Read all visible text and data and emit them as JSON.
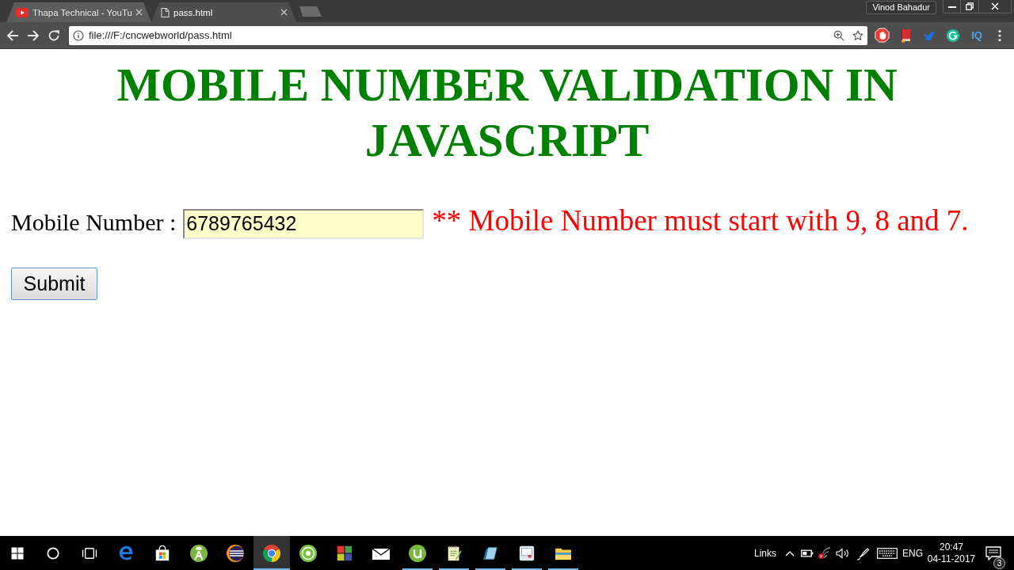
{
  "browser": {
    "tabs": [
      {
        "kind": "video",
        "title": "Thapa Technical - YouTu",
        "selected": false
      },
      {
        "kind": "page",
        "title": "pass.html",
        "selected": true
      }
    ],
    "profile": "Vinod Bahadur",
    "address": "file:///F:/cncwebworld/pass.html",
    "extensions": [
      {
        "kind": "stop"
      },
      {
        "kind": "book"
      },
      {
        "kind": "bird"
      },
      {
        "kind": "gcircle"
      },
      {
        "kind": "text",
        "label": "IQ"
      }
    ]
  },
  "page": {
    "heading": "MOBILE NUMBER VALIDATION IN JAVASCRIPT",
    "form": {
      "label": "Mobile Number :",
      "value": "6789765432",
      "error": "** Mobile Number must start with 9, 8 and 7.",
      "submit": "Submit"
    }
  },
  "taskbar": {
    "apps": [
      {
        "kind": "edge",
        "running": false,
        "selected": false
      },
      {
        "kind": "store",
        "running": false,
        "selected": false
      },
      {
        "kind": "studio",
        "running": false,
        "selected": false
      },
      {
        "kind": "eclipse",
        "running": false,
        "selected": false
      },
      {
        "kind": "chrome",
        "running": true,
        "selected": true
      },
      {
        "kind": "tcircle",
        "running": false,
        "selected": false
      },
      {
        "kind": "tiles",
        "running": false,
        "selected": false
      },
      {
        "kind": "mail",
        "running": false,
        "selected": false
      },
      {
        "kind": "torrent",
        "running": true,
        "selected": false
      },
      {
        "kind": "notepadpp",
        "running": true,
        "selected": false
      },
      {
        "kind": "notepad",
        "running": true,
        "selected": false
      },
      {
        "kind": "monitor",
        "running": true,
        "selected": false
      },
      {
        "kind": "folder",
        "running": true,
        "selected": false
      }
    ],
    "tray": {
      "links_label": "Links",
      "language": "ENG",
      "time": "20:47",
      "date": "04-11-2017",
      "notification_count": "3"
    }
  }
}
